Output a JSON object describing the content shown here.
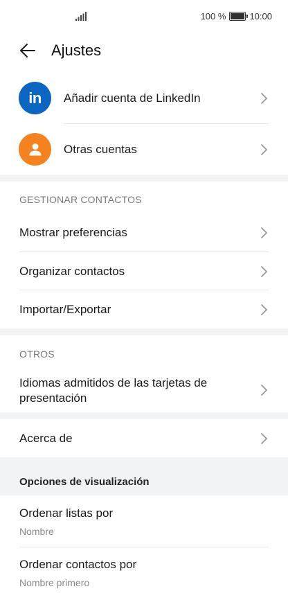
{
  "status_bar": {
    "battery": "100 %",
    "battery_level": 1.0,
    "time": "10:00"
  },
  "header": {
    "title": "Ajustes"
  },
  "accounts": [
    {
      "label": "Añadir cuenta de LinkedIn",
      "icon": "linkedin-icon",
      "color": "#0a66c2"
    },
    {
      "label": "Otras cuentas",
      "icon": "person-icon",
      "color": "#f5821f"
    }
  ],
  "manage_contacts": {
    "header": "GESTIONAR CONTACTOS",
    "items": [
      {
        "label": "Mostrar preferencias"
      },
      {
        "label": "Organizar contactos"
      },
      {
        "label": "Importar/Exportar"
      }
    ]
  },
  "others": {
    "header": "OTROS",
    "items": [
      {
        "label_line1": "Idiomas admitidos de las tarjetas de",
        "label_line2": "presentación"
      }
    ]
  },
  "about": {
    "label": "Acerca de"
  },
  "display_options": {
    "header": "Opciones de visualización",
    "items": [
      {
        "label": "Ordenar listas por",
        "value": "Nombre"
      },
      {
        "label": "Ordenar contactos por",
        "value": "Nombre primero"
      }
    ]
  }
}
